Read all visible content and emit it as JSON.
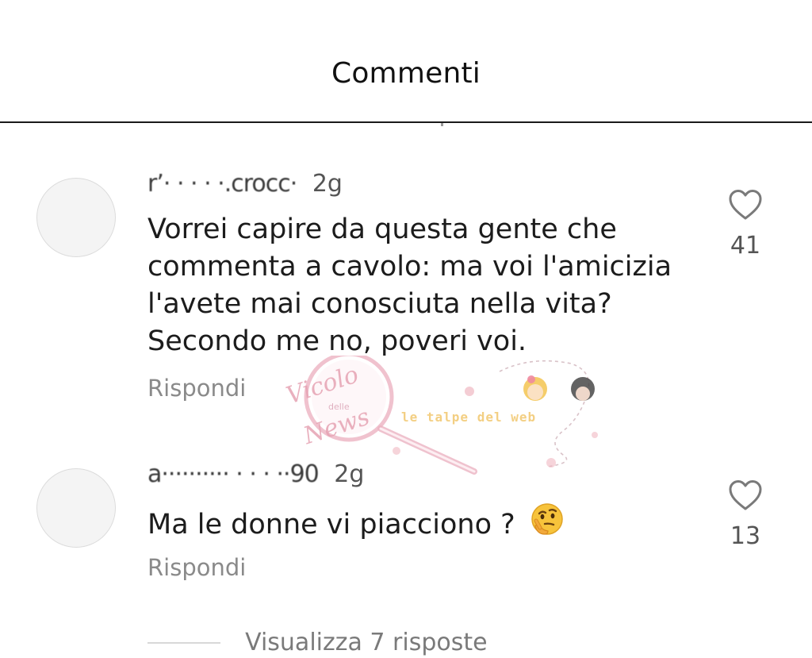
{
  "header": {
    "title": "Commenti"
  },
  "comments": [
    {
      "username": "r’·  · ·  ·  ·.crocc·",
      "time": "2g",
      "text": "Vorrei capire da questa gente che commenta a cavolo: ma voi l'amicizia l'avete mai conosciuta nella vita? Secondo me no, poveri voi.",
      "reply_label": "Rispondi",
      "likes": "41"
    },
    {
      "username": "a·········· · · · ··90",
      "time": "2g",
      "text": "Ma le donne vi piacciono ?",
      "emoji": "thinking-face",
      "reply_label": "Rispondi",
      "likes": "13"
    }
  ],
  "view_replies": {
    "label": "Visualizza 7 risposte"
  },
  "watermark": {
    "logo_line1": "Vicolo",
    "logo_small": "delle",
    "logo_line2": "News",
    "tagline": "le talpe del web"
  },
  "icons": {
    "like": "heart-outline-icon",
    "emoji": "thinking-face-emoji"
  },
  "colors": {
    "title": "#111111",
    "text": "#1c1c1c",
    "muted": "#8a8a8a",
    "divider": "#1a1a1a",
    "watermark_pink": "#e6a3b3",
    "watermark_yellow": "#f2c76e"
  }
}
